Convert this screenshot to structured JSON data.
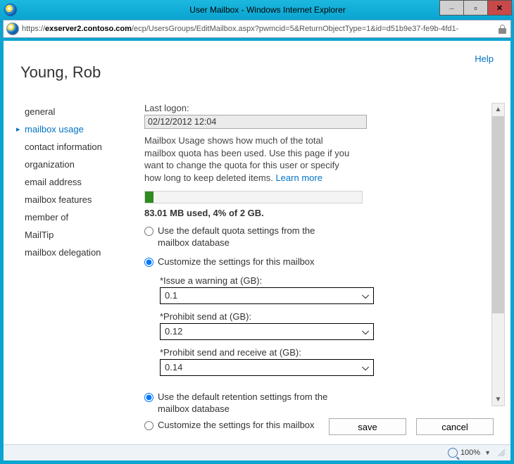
{
  "window": {
    "title": "User Mailbox - Windows Internet Explorer",
    "minimize": "—",
    "maximize": "□",
    "close": "X",
    "url_prefix": "https://",
    "url_host": "exserver2.contoso.com",
    "url_path": "/ecp/UsersGroups/EditMailbox.aspx?pwmcid=5&ReturnObjectType=1&id=d51b9e37-fe9b-4fd1-"
  },
  "help": "Help",
  "page_title": "Young, Rob",
  "sidebar": {
    "items": [
      {
        "label": "general"
      },
      {
        "label": "mailbox usage"
      },
      {
        "label": "contact information"
      },
      {
        "label": "organization"
      },
      {
        "label": "email address"
      },
      {
        "label": "mailbox features"
      },
      {
        "label": "member of"
      },
      {
        "label": "MailTip"
      },
      {
        "label": "mailbox delegation"
      }
    ],
    "selected_index": 1
  },
  "main": {
    "last_logon_label": "Last logon:",
    "last_logon_value": "02/12/2012 12:04",
    "description": "Mailbox Usage shows how much of the total mailbox quota has been used. Use this page if you want to change the quota for this user or specify how long to keep deleted items. ",
    "learn_more": "Learn more",
    "usage_text": "83.01 MB used, 4% of 2 GB.",
    "progress_percent": 4,
    "quota": {
      "opt_default": "Use the default quota settings from the mailbox database",
      "opt_custom": "Customize the settings for this mailbox",
      "selected": "custom",
      "warn_label": "*Issue a warning at (GB):",
      "warn_value": "0.1",
      "send_label": "*Prohibit send at (GB):",
      "send_value": "0.12",
      "sendrecv_label": "*Prohibit send and receive at (GB):",
      "sendrecv_value": "0.14"
    },
    "retention": {
      "opt_default": "Use the default retention settings from the mailbox database",
      "opt_custom": "Customize the settings for this mailbox",
      "selected": "default"
    }
  },
  "buttons": {
    "save": "save",
    "cancel": "cancel"
  },
  "status": {
    "zoom": "100%"
  }
}
